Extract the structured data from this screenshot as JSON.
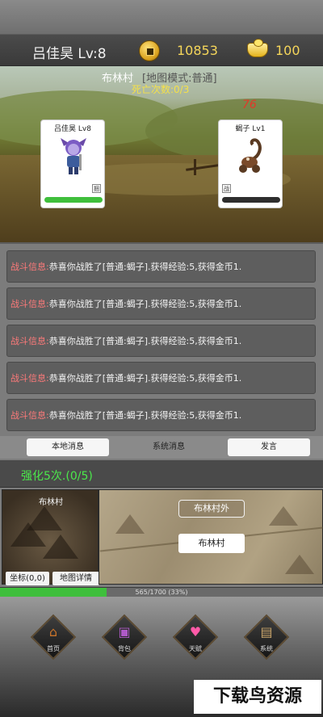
{
  "header": {
    "player_title": "吕佳昊 Lv:8",
    "gold": "10853",
    "ingot": "100"
  },
  "scene": {
    "map_name": "布林村",
    "map_mode": "[地图模式:普通]",
    "death_count": "死亡次数:0/3",
    "damage": "76",
    "player_card": {
      "name": "吕佳昊 Lv8",
      "tag": "捆",
      "hp_fraction": 1.0
    },
    "enemy_card": {
      "name": "蝎子 Lv1",
      "tag": "战",
      "hp_fraction": 0.0
    }
  },
  "log": {
    "prefix": "战斗信息:",
    "entries": [
      "恭喜你战胜了[普通:蝎子].获得经验:5,获得金币1.",
      "恭喜你战胜了[普通:蝎子].获得经验:5,获得金币1.",
      "恭喜你战胜了[普通:蝎子].获得经验:5,获得金币1.",
      "恭喜你战胜了[普通:蝎子].获得经验:5,获得金币1.",
      "恭喜你战胜了[普通:蝎子].获得经验:5,获得金币1."
    ]
  },
  "tabs": {
    "local": "本地消息",
    "system": "系统消息",
    "speak": "发言"
  },
  "enhance": {
    "text": "强化5次.(0/5)"
  },
  "minimap": {
    "title": "布林村",
    "coord_button": "坐标(0,0)",
    "detail_button": "地图详情"
  },
  "world_map": {
    "outer_location": "布林村外",
    "current_location": "布林村"
  },
  "exp": {
    "text": "565/1700 (33%)",
    "fraction": 0.33
  },
  "nav": {
    "home": "首页",
    "bag": "背包",
    "talent": "天赋",
    "system": "系统"
  },
  "watermark": "下载鸟资源",
  "colors": {
    "gold_text": "#f5d65a",
    "log_prefix": "#ff7a7a",
    "enhance_text": "#4be84b",
    "hp_green": "#3fbf3c",
    "damage_red": "#e2382a"
  }
}
